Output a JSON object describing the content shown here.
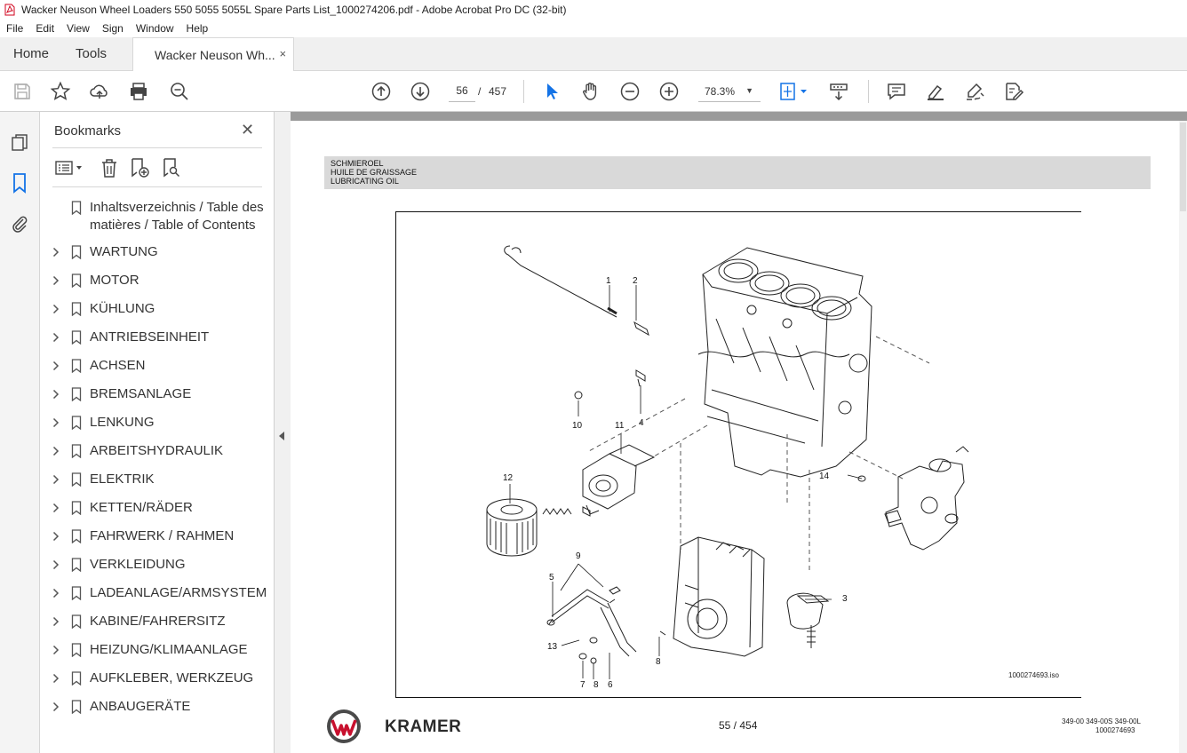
{
  "window": {
    "title": "Wacker Neuson Wheel Loaders 550 5055 5055L Spare Parts List_1000274206.pdf - Adobe Acrobat Pro DC (32-bit)"
  },
  "menu": [
    "File",
    "Edit",
    "View",
    "Sign",
    "Window",
    "Help"
  ],
  "tabs": {
    "home": "Home",
    "tools": "Tools",
    "document": "Wacker Neuson Wh...",
    "close_glyph": "×"
  },
  "toolbar": {
    "icons": [
      "save-icon",
      "star-icon",
      "upload-icon",
      "print-icon",
      "search-zoom-icon",
      "prev-page-icon",
      "next-page-icon",
      "select-cursor-icon",
      "hand-icon",
      "zoom-out-icon",
      "zoom-in-icon",
      "fit-page-icon",
      "scroll-mode-icon",
      "comment-icon",
      "highlight-icon",
      "sign-icon",
      "edit-icon"
    ],
    "current_page": "56",
    "page_separator": "/",
    "total_pages": "457",
    "zoom": "78.3%",
    "accent_color": "#1473e6"
  },
  "bookmarks_panel": {
    "title": "Bookmarks",
    "close_glyph": "✕",
    "items": [
      {
        "label_line1": "Inhaltsverzeichnis / Table des",
        "label_line2": "matières / Table of Contents",
        "expandable": false
      },
      {
        "label": "WARTUNG",
        "expandable": true
      },
      {
        "label": "MOTOR",
        "expandable": true
      },
      {
        "label": "KÜHLUNG",
        "expandable": true
      },
      {
        "label": "ANTRIEBSEINHEIT",
        "expandable": true
      },
      {
        "label": "ACHSEN",
        "expandable": true
      },
      {
        "label": "BREMSANLAGE",
        "expandable": true
      },
      {
        "label": "LENKUNG",
        "expandable": true
      },
      {
        "label": "ARBEITSHYDRAULIK",
        "expandable": true
      },
      {
        "label": "ELEKTRIK",
        "expandable": true
      },
      {
        "label": "KETTEN/RÄDER",
        "expandable": true
      },
      {
        "label": "FAHRWERK / RAHMEN",
        "expandable": true
      },
      {
        "label": "VERKLEIDUNG",
        "expandable": true
      },
      {
        "label": "LADEANLAGE/ARMSYSTEM",
        "expandable": true
      },
      {
        "label": "KABINE/FAHRERSITZ",
        "expandable": true
      },
      {
        "label": "HEIZUNG/KLIMAANLAGE",
        "expandable": true
      },
      {
        "label": "AUFKLEBER, WERKZEUG",
        "expandable": true
      },
      {
        "label": "ANBAUGERÄTE",
        "expandable": true
      }
    ]
  },
  "pdf_page": {
    "section_heading": {
      "de": "SCHMIEROEL",
      "fr": "HUILE DE GRAISSAGE",
      "en": "LUBRICATING OIL"
    },
    "callouts": [
      "1",
      "2",
      "3",
      "4",
      "5",
      "6",
      "7",
      "8",
      "8",
      "9",
      "10",
      "11",
      "12",
      "13",
      "14"
    ],
    "drawing_reference": "1000274693.iso",
    "footer": {
      "brand": "KRAMER",
      "page_label": "55 / 454",
      "code_line1": "349-00  349-00S  349-00L",
      "code_line2": "1000274693",
      "logo_color": "#c8102e"
    }
  }
}
